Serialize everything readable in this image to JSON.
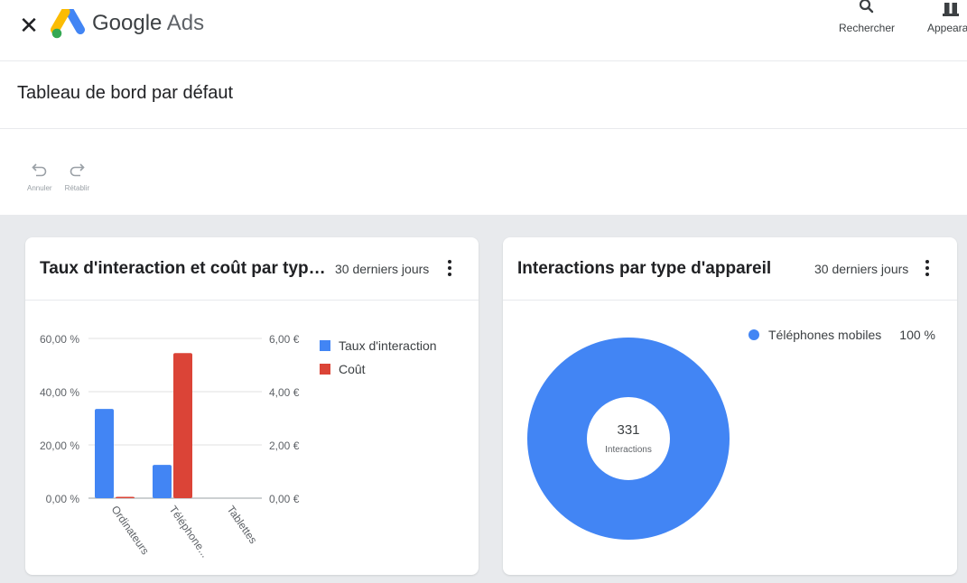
{
  "header": {
    "close_icon": "close-icon",
    "brand_google": "Google",
    "brand_ads": "Ads",
    "search_label": "Rechercher",
    "appearance_label": "Appearan"
  },
  "page": {
    "title": "Tableau de bord par défaut",
    "undo_label": "Annuler",
    "redo_label": "Rétablir"
  },
  "colors": {
    "blue": "#4285f4",
    "red": "#db4437",
    "canvas": "#e8eaed"
  },
  "cards": [
    {
      "title": "Taux d'interaction et coût par type d'appareil",
      "range": "30 derniers jours"
    },
    {
      "title": "Interactions par type d'appareil",
      "range": "30 derniers jours"
    }
  ],
  "chart_data": [
    {
      "type": "bar",
      "categories": [
        "Ordinateurs",
        "Téléphone...",
        "Tablettes"
      ],
      "series": [
        {
          "name": "Taux d'interaction",
          "values": [
            33.5,
            12.5,
            0
          ],
          "axis": "left",
          "color": "#4285f4"
        },
        {
          "name": "Coût",
          "values": [
            0.05,
            5.45,
            0
          ],
          "axis": "right",
          "color": "#db4437"
        }
      ],
      "y_left": {
        "ticks": [
          "0,00 %",
          "20,00 %",
          "40,00 %",
          "60,00 %"
        ],
        "range": [
          0,
          60
        ]
      },
      "y_right": {
        "ticks": [
          "0,00 €",
          "2,00 €",
          "4,00 €",
          "6,00 €"
        ],
        "range": [
          0,
          6
        ]
      },
      "grid": true,
      "legend": "right"
    },
    {
      "type": "pie",
      "donut": true,
      "slices": [
        {
          "label": "Téléphones mobiles",
          "value": 100,
          "display": "100 %",
          "color": "#4285f4"
        }
      ],
      "center_value": "331",
      "center_label": "Interactions",
      "legend": "top-right"
    }
  ]
}
